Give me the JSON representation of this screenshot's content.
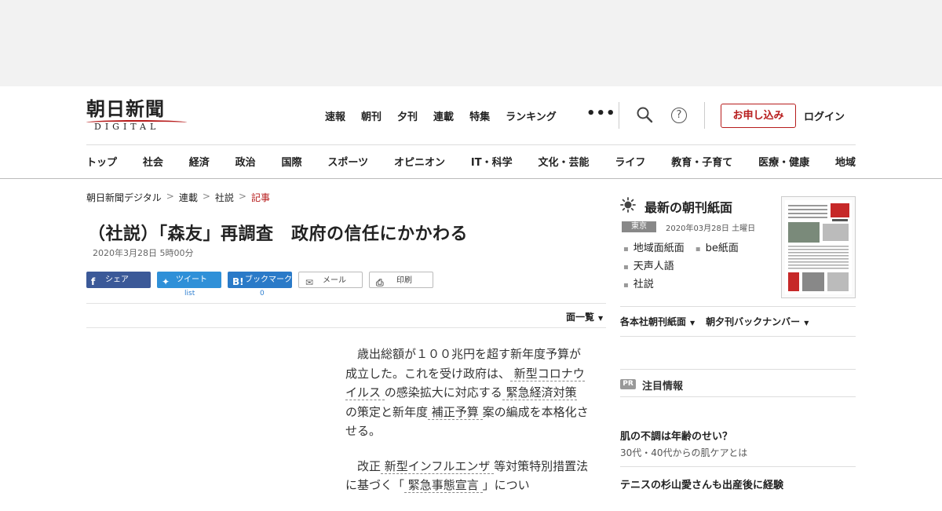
{
  "header": {
    "logo_main": "朝日新聞",
    "logo_sub": "DIGITAL",
    "topnav": [
      "速報",
      "朝刊",
      "夕刊",
      "連載",
      "特集",
      "ランキング"
    ],
    "more_icon": "more-dots-icon",
    "search_icon": "search-icon",
    "help_icon": "help-icon",
    "help_glyph": "?",
    "subscribe_label": "お申し込み",
    "login_label": "ログイン",
    "categories": [
      "トップ",
      "社会",
      "経済",
      "政治",
      "国際",
      "スポーツ",
      "オピニオン",
      "IT・科学",
      "文化・芸能",
      "ライフ",
      "教育・子育て",
      "医療・健康",
      "地域"
    ],
    "accent": "#b71c1c"
  },
  "breadcrumb": {
    "items": [
      "朝日新聞デジタル",
      "連載",
      "社説"
    ],
    "current": "記事",
    "separator": ">"
  },
  "article": {
    "title": "（社説）「森友」再調査　政府の信任にかかわる",
    "date": "2020年3月28日 5時00分",
    "share": {
      "facebook": "シェア",
      "twitter": "ツイート",
      "twitter_count": "list",
      "hatena": "ブックマーク",
      "hatena_icon_text": "B!",
      "hatena_count": "0",
      "mail": "メール",
      "print": "印刷"
    },
    "list_label": "面一覧",
    "paragraphs": [
      {
        "parts": [
          {
            "t": "歳出総額が１００兆円を超す新年度予算が成立した。これを受け政府は、"
          },
          {
            "t": "新型コロナウイルス",
            "kw": true
          },
          {
            "t": "の感染拡大に対応する"
          },
          {
            "t": "緊急経済対策",
            "kw": true
          },
          {
            "t": "の策定と新年度"
          },
          {
            "t": "補正予算",
            "kw": true
          },
          {
            "t": "案の編成を本格化させる。"
          }
        ]
      },
      {
        "parts": [
          {
            "t": "改正"
          },
          {
            "t": "新型インフルエンザ",
            "kw": true
          },
          {
            "t": "等対策特別措置法に基づく「"
          },
          {
            "t": "緊急事態宣言",
            "kw": true
          },
          {
            "t": "」につい"
          }
        ]
      }
    ]
  },
  "sidebar": {
    "paper_title": "最新の朝刊紙面",
    "region": "東京",
    "paper_date": "2020年03月28日 土曜日",
    "paper_links": [
      [
        "地域面紙面",
        "be紙面"
      ],
      [
        "天声人語"
      ],
      [
        "社説"
      ]
    ],
    "menu": [
      "各本社朝刊紙面",
      "朝夕刊バックナンバー"
    ],
    "pr_badge": "PR",
    "pr_title": "注目情報",
    "pr_items": [
      {
        "head": "肌の不調は年齢のせい？",
        "sub": "30代・40代からの肌ケアとは"
      },
      {
        "head": "テニスの杉山愛さんも出産後に経験",
        "sub": ""
      }
    ]
  }
}
